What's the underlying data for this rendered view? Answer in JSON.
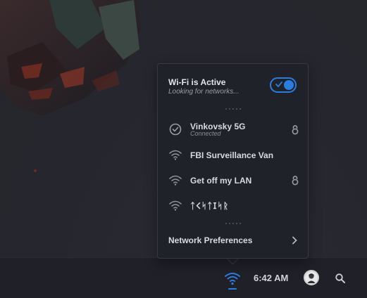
{
  "popup": {
    "title": "Wi-Fi is Active",
    "subtitle": "Looking for networks...",
    "toggle_on": true,
    "networks": [
      {
        "name": "Vinkovsky 5G",
        "status": "Connected",
        "icon": "check-circle-icon",
        "secured": true
      },
      {
        "name": "FBI Surveillance Van",
        "status": "",
        "icon": "wifi-icon",
        "secured": false
      },
      {
        "name": "Get off my LAN",
        "status": "",
        "icon": "wifi-icon",
        "secured": true
      },
      {
        "name": "ᛏ𐌂ᛋᛏ𐌆ᛋᚱ",
        "status": "",
        "icon": "wifi-icon",
        "secured": false
      }
    ],
    "preferences_label": "Network Preferences"
  },
  "taskbar": {
    "time": "6:42 AM",
    "wifi_icon": "wifi-icon",
    "avatar": "avatar",
    "search_icon": "search-icon"
  },
  "colors": {
    "accent": "#2a7de1",
    "popup_bg": "#20222a",
    "taskbar_bg": "#1f2028"
  }
}
